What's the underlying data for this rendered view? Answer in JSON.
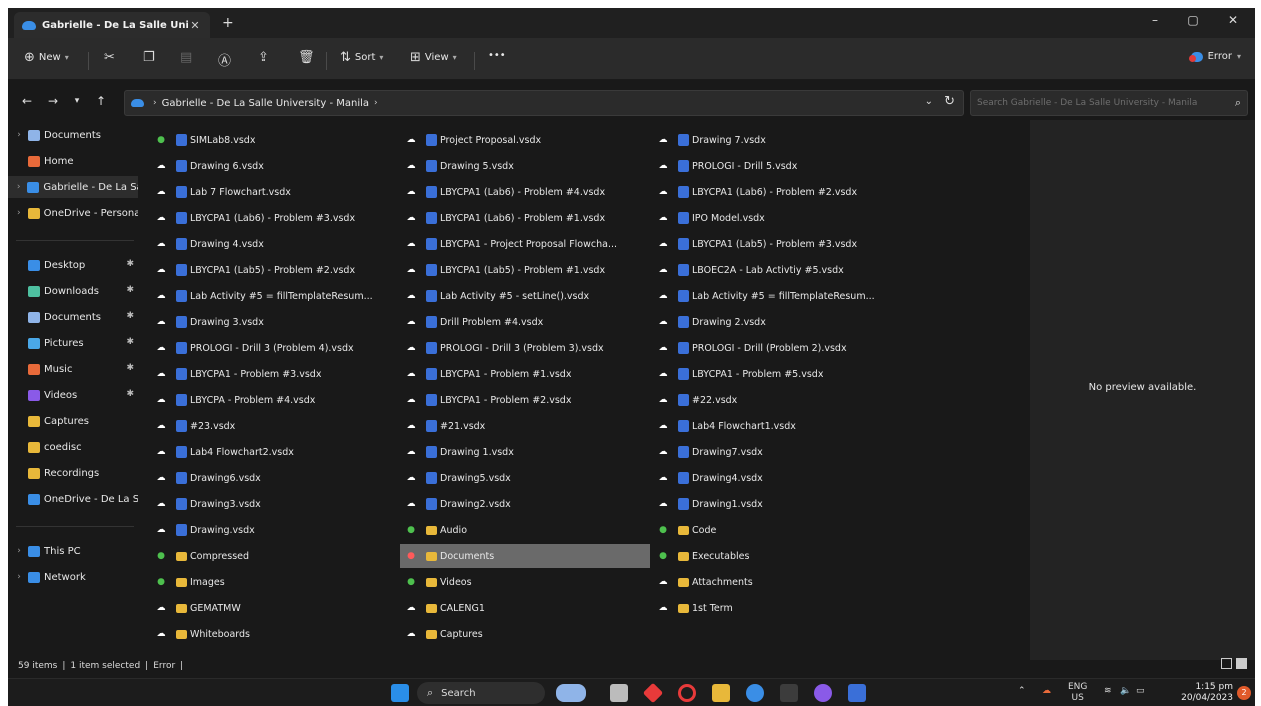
{
  "window": {
    "tab_title": "Gabrielle - De La Salle Univer",
    "new_tab": "+",
    "minimize": "–",
    "maximize": "▢",
    "close": "✕"
  },
  "toolbar": {
    "new_label": "New",
    "sort_label": "Sort",
    "view_label": "View",
    "more_label": "•••",
    "error_label": "Error"
  },
  "address": {
    "path": "Gabrielle - De La Salle University - Manila",
    "search_placeholder": "Search Gabrielle - De La Salle University - Manila"
  },
  "sidebar": {
    "items": [
      {
        "label": "Documents",
        "icon": "documents-icon",
        "color": "#8fb4e8",
        "chevron": true,
        "pinned": false
      },
      {
        "label": "Home",
        "icon": "home-icon",
        "color": "#e86a3a",
        "chevron": false,
        "pinned": false
      },
      {
        "label": "Gabrielle - De La Sa",
        "icon": "onedrive-icon",
        "color": "#3a8ee6",
        "chevron": true,
        "pinned": false
      },
      {
        "label": "OneDrive - Persona",
        "icon": "folder-icon",
        "color": "#e8b83a",
        "chevron": true,
        "pinned": false
      },
      {
        "label": "Desktop",
        "icon": "desktop-icon",
        "color": "#3a8ee6",
        "chevron": false,
        "pinned": true
      },
      {
        "label": "Downloads",
        "icon": "downloads-icon",
        "color": "#4ec0a0",
        "chevron": false,
        "pinned": true
      },
      {
        "label": "Documents",
        "icon": "documents-icon",
        "color": "#8fb4e8",
        "chevron": false,
        "pinned": true
      },
      {
        "label": "Pictures",
        "icon": "pictures-icon",
        "color": "#4aa8e8",
        "chevron": false,
        "pinned": true
      },
      {
        "label": "Music",
        "icon": "music-icon",
        "color": "#e86a3a",
        "chevron": false,
        "pinned": true
      },
      {
        "label": "Videos",
        "icon": "videos-icon",
        "color": "#8a5ae8",
        "chevron": false,
        "pinned": true
      },
      {
        "label": "Captures",
        "icon": "folder-icon",
        "color": "#e8b83a",
        "chevron": false,
        "pinned": false
      },
      {
        "label": "coedisc",
        "icon": "folder-icon",
        "color": "#e8b83a",
        "chevron": false,
        "pinned": false
      },
      {
        "label": "Recordings",
        "icon": "folder-icon",
        "color": "#e8b83a",
        "chevron": false,
        "pinned": false
      },
      {
        "label": "OneDrive - De La S",
        "icon": "onedrive-icon",
        "color": "#3a8ee6",
        "chevron": false,
        "pinned": false
      },
      {
        "label": "This PC",
        "icon": "this-pc-icon",
        "color": "#3a8ee6",
        "chevron": true,
        "pinned": false
      },
      {
        "label": "Network",
        "icon": "network-icon",
        "color": "#3a8ee6",
        "chevron": true,
        "pinned": false
      }
    ]
  },
  "files": [
    [
      {
        "name": "SIMLab8.vsdx",
        "status": "ok",
        "type": "vsdx"
      },
      {
        "name": "Drawing 6.vsdx",
        "status": "cloud",
        "type": "vsdx"
      },
      {
        "name": "Lab 7 Flowchart.vsdx",
        "status": "cloud",
        "type": "vsdx"
      },
      {
        "name": "LBYCPA1 (Lab6) - Problem #3.vsdx",
        "status": "cloud",
        "type": "vsdx"
      },
      {
        "name": "Drawing 4.vsdx",
        "status": "cloud",
        "type": "vsdx"
      },
      {
        "name": "LBYCPA1 (Lab5) - Problem #2.vsdx",
        "status": "cloud",
        "type": "vsdx"
      },
      {
        "name": "Lab Activity #5 = fillTemplateResum...",
        "status": "cloud",
        "type": "vsdx"
      },
      {
        "name": "Drawing 3.vsdx",
        "status": "cloud",
        "type": "vsdx"
      },
      {
        "name": "PROLOGI - Drill 3 (Problem 4).vsdx",
        "status": "cloud",
        "type": "vsdx"
      },
      {
        "name": "LBYCPA1 - Problem #3.vsdx",
        "status": "cloud",
        "type": "vsdx"
      },
      {
        "name": "LBYCPA - Problem #4.vsdx",
        "status": "cloud",
        "type": "vsdx"
      },
      {
        "name": "#23.vsdx",
        "status": "cloud",
        "type": "vsdx"
      },
      {
        "name": "Lab4 Flowchart2.vsdx",
        "status": "cloud",
        "type": "vsdx"
      },
      {
        "name": "Drawing6.vsdx",
        "status": "cloud",
        "type": "vsdx"
      },
      {
        "name": "Drawing3.vsdx",
        "status": "cloud",
        "type": "vsdx"
      },
      {
        "name": "Drawing.vsdx",
        "status": "cloud",
        "type": "vsdx"
      },
      {
        "name": "Compressed",
        "status": "ok",
        "type": "folder"
      },
      {
        "name": "Images",
        "status": "ok",
        "type": "folder"
      },
      {
        "name": "GEMATMW",
        "status": "cloud",
        "type": "folder"
      },
      {
        "name": "Whiteboards",
        "status": "cloud",
        "type": "folder"
      }
    ],
    [
      {
        "name": "Project Proposal.vsdx",
        "status": "cloud",
        "type": "vsdx"
      },
      {
        "name": "Drawing 5.vsdx",
        "status": "cloud",
        "type": "vsdx"
      },
      {
        "name": "LBYCPA1 (Lab6) - Problem #4.vsdx",
        "status": "cloud",
        "type": "vsdx"
      },
      {
        "name": "LBYCPA1 (Lab6) - Problem #1.vsdx",
        "status": "cloud",
        "type": "vsdx"
      },
      {
        "name": "LBYCPA1 - Project Proposal Flowcha...",
        "status": "cloud",
        "type": "vsdx"
      },
      {
        "name": "LBYCPA1 (Lab5) - Problem #1.vsdx",
        "status": "cloud",
        "type": "vsdx"
      },
      {
        "name": "Lab Activity #5 - setLine().vsdx",
        "status": "cloud",
        "type": "vsdx"
      },
      {
        "name": "Drill Problem #4.vsdx",
        "status": "cloud",
        "type": "vsdx"
      },
      {
        "name": "PROLOGI - Drill 3 (Problem 3).vsdx",
        "status": "cloud",
        "type": "vsdx"
      },
      {
        "name": "LBYCPA1 - Problem #1.vsdx",
        "status": "cloud",
        "type": "vsdx"
      },
      {
        "name": "LBYCPA1 - Problem #2.vsdx",
        "status": "cloud",
        "type": "vsdx"
      },
      {
        "name": "#21.vsdx",
        "status": "cloud",
        "type": "vsdx"
      },
      {
        "name": "Drawing 1.vsdx",
        "status": "cloud",
        "type": "vsdx"
      },
      {
        "name": "Drawing5.vsdx",
        "status": "cloud",
        "type": "vsdx"
      },
      {
        "name": "Drawing2.vsdx",
        "status": "cloud",
        "type": "vsdx"
      },
      {
        "name": "Audio",
        "status": "ok",
        "type": "folder"
      },
      {
        "name": "Documents",
        "status": "err",
        "type": "folder",
        "selected": true
      },
      {
        "name": "Videos",
        "status": "ok",
        "type": "folder"
      },
      {
        "name": "CALENG1",
        "status": "cloud",
        "type": "folder"
      },
      {
        "name": "Captures",
        "status": "cloud",
        "type": "folder"
      }
    ],
    [
      {
        "name": "Drawing 7.vsdx",
        "status": "cloud",
        "type": "vsdx"
      },
      {
        "name": "PROLOGI - Drill 5.vsdx",
        "status": "cloud",
        "type": "vsdx"
      },
      {
        "name": "LBYCPA1 (Lab6) - Problem #2.vsdx",
        "status": "cloud",
        "type": "vsdx"
      },
      {
        "name": "IPO Model.vsdx",
        "status": "cloud",
        "type": "vsdx"
      },
      {
        "name": "LBYCPA1 (Lab5) - Problem #3.vsdx",
        "status": "cloud",
        "type": "vsdx"
      },
      {
        "name": "LBOEC2A - Lab Activtiy #5.vsdx",
        "status": "cloud",
        "type": "vsdx"
      },
      {
        "name": "Lab Activity #5 = fillTemplateResum...",
        "status": "cloud",
        "type": "vsdx"
      },
      {
        "name": "Drawing 2.vsdx",
        "status": "cloud",
        "type": "vsdx"
      },
      {
        "name": "PROLOGI - Drill (Problem 2).vsdx",
        "status": "cloud",
        "type": "vsdx"
      },
      {
        "name": "LBYCPA1 - Problem #5.vsdx",
        "status": "cloud",
        "type": "vsdx"
      },
      {
        "name": "#22.vsdx",
        "status": "cloud",
        "type": "vsdx"
      },
      {
        "name": "Lab4 Flowchart1.vsdx",
        "status": "cloud",
        "type": "vsdx"
      },
      {
        "name": "Drawing7.vsdx",
        "status": "cloud",
        "type": "vsdx"
      },
      {
        "name": "Drawing4.vsdx",
        "status": "cloud",
        "type": "vsdx"
      },
      {
        "name": "Drawing1.vsdx",
        "status": "cloud",
        "type": "vsdx"
      },
      {
        "name": "Code",
        "status": "ok",
        "type": "folder"
      },
      {
        "name": "Executables",
        "status": "ok",
        "type": "folder"
      },
      {
        "name": "Attachments",
        "status": "cloud",
        "type": "folder"
      },
      {
        "name": "1st Term",
        "status": "cloud",
        "type": "folder"
      }
    ]
  ],
  "preview": {
    "text": "No preview available."
  },
  "status": {
    "items": "59 items",
    "selected": "1 item selected",
    "error": "Error"
  },
  "taskbar": {
    "search_label": "Search",
    "lang": "ENG",
    "region": "US",
    "time": "1:15 pm",
    "date": "20/04/2023",
    "notifications": "2"
  }
}
